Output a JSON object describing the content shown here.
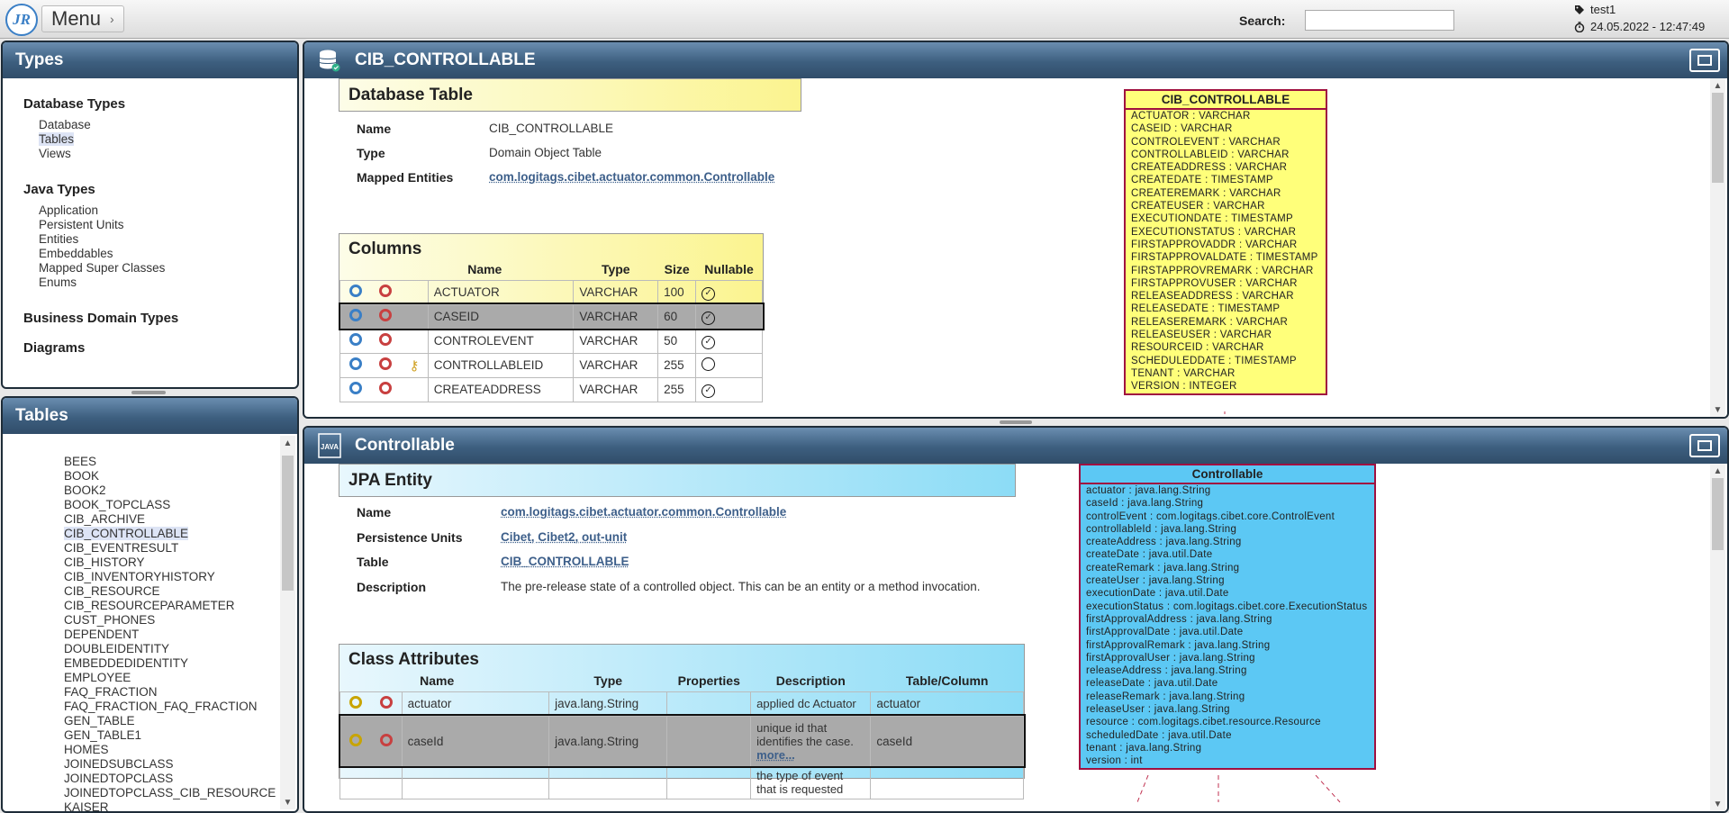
{
  "topbar": {
    "logo": "JR",
    "menu_label": "Menu",
    "search_label": "Search:",
    "search_value": "",
    "user": "test1",
    "datetime": "24.05.2022 - 12:47:49"
  },
  "types_panel": {
    "title": "Types",
    "groups": [
      {
        "label": "Database Types",
        "items": [
          "Database",
          "Tables",
          "Views"
        ]
      },
      {
        "label": "Java Types",
        "items": [
          "Application",
          "Persistent Units",
          "Entities",
          "Embeddables",
          "Mapped Super Classes",
          "Enums"
        ]
      },
      {
        "label": "Business Domain Types",
        "items": []
      },
      {
        "label": "Diagrams",
        "items": []
      }
    ],
    "selected_item": "Tables"
  },
  "tables_panel": {
    "title": "Tables",
    "items": [
      "BEES",
      "BOOK",
      "BOOK2",
      "BOOK_TOPCLASS",
      "CIB_ARCHIVE",
      "CIB_CONTROLLABLE",
      "CIB_EVENTRESULT",
      "CIB_HISTORY",
      "CIB_INVENTORYHISTORY",
      "CIB_RESOURCE",
      "CIB_RESOURCEPARAMETER",
      "CUST_PHONES",
      "DEPENDENT",
      "DOUBLEIDENTITY",
      "EMBEDDEDIDENTITY",
      "EMPLOYEE",
      "FAQ_FRACTION",
      "FAQ_FRACTION_FAQ_FRACTION",
      "GEN_TABLE",
      "GEN_TABLE1",
      "HOMES",
      "JOINEDSUBCLASS",
      "JOINEDTOPCLASS",
      "JOINEDTOPCLASS_CIB_RESOURCE",
      "KAISER"
    ],
    "selected": "CIB_CONTROLLABLE"
  },
  "db_panel": {
    "title": "CIB_CONTROLLABLE",
    "section_title": "Database Table",
    "props": [
      {
        "label": "Name",
        "value": "CIB_CONTROLLABLE"
      },
      {
        "label": "Type",
        "value": "Domain Object Table"
      },
      {
        "label": "Mapped Entities",
        "value": "com.logitags.cibet.actuator.common.Controllable"
      }
    ],
    "columns_title": "Columns",
    "columns_headers": [
      "Name",
      "Type",
      "Size",
      "Nullable"
    ],
    "columns": [
      {
        "name": "ACTUATOR",
        "type": "VARCHAR",
        "size": "100",
        "nullable": true,
        "key": false
      },
      {
        "name": "CASEID",
        "type": "VARCHAR",
        "size": "60",
        "nullable": true,
        "key": false
      },
      {
        "name": "CONTROLEVENT",
        "type": "VARCHAR",
        "size": "50",
        "nullable": true,
        "key": false
      },
      {
        "name": "CONTROLLABLEID",
        "type": "VARCHAR",
        "size": "255",
        "nullable": false,
        "key": true
      },
      {
        "name": "CREATEADDRESS",
        "type": "VARCHAR",
        "size": "255",
        "nullable": true,
        "key": false
      }
    ],
    "uml_title": "CIB_CONTROLLABLE",
    "uml_rows": [
      "ACTUATOR : VARCHAR",
      "CASEID : VARCHAR",
      "CONTROLEVENT : VARCHAR",
      "CONTROLLABLEID : VARCHAR",
      "CREATEADDRESS : VARCHAR",
      "CREATEDATE : TIMESTAMP",
      "CREATEREMARK : VARCHAR",
      "CREATEUSER : VARCHAR",
      "EXECUTIONDATE : TIMESTAMP",
      "EXECUTIONSTATUS : VARCHAR",
      "FIRSTAPPROVADDR : VARCHAR",
      "FIRSTAPPROVALDATE : TIMESTAMP",
      "FIRSTAPPROVREMARK : VARCHAR",
      "FIRSTAPPROVUSER : VARCHAR",
      "RELEASEADDRESS : VARCHAR",
      "RELEASEDATE : TIMESTAMP",
      "RELEASEREMARK : VARCHAR",
      "RELEASEUSER : VARCHAR",
      "RESOURCEID : VARCHAR",
      "SCHEDULEDDATE : TIMESTAMP",
      "TENANT : VARCHAR",
      "VERSION : INTEGER"
    ]
  },
  "jpa_panel": {
    "title": "Controllable",
    "icon_label": "JAVA",
    "section_title": "JPA Entity",
    "name_label": "Name",
    "name_value": "com.logitags.cibet.actuator.common.Controllable",
    "pu_label": "Persistence Units",
    "pu_values": [
      "Cibet",
      "Cibet2",
      "out-unit"
    ],
    "table_label": "Table",
    "table_value": "CIB_CONTROLLABLE",
    "desc_label": "Description",
    "desc_value": "The pre-release state of a controlled object. This can be an entity or a method invocation.",
    "attrs_title": "Class Attributes",
    "attrs_headers": [
      "Name",
      "Type",
      "Properties",
      "Description",
      "Table/Column"
    ],
    "attrs": [
      {
        "name": "actuator",
        "type": "java.lang.String",
        "props": "",
        "desc": "applied dc Actuator",
        "more": "",
        "col": "actuator"
      },
      {
        "name": "caseId",
        "type": "java.lang.String",
        "props": "",
        "desc": "unique id that identifies the case.",
        "more": "more...",
        "col": "caseId"
      },
      {
        "name": "",
        "type": "",
        "props": "",
        "desc": "the type of event that is requested",
        "more": "",
        "col": ""
      }
    ],
    "uml_title": "Controllable",
    "uml_rows": [
      "actuator : java.lang.String",
      "caseId : java.lang.String",
      "controlEvent : com.logitags.cibet.core.ControlEvent",
      "controllableId : java.lang.String",
      "createAddress : java.lang.String",
      "createDate : java.util.Date",
      "createRemark : java.lang.String",
      "createUser : java.lang.String",
      "executionDate : java.util.Date",
      "executionStatus : com.logitags.cibet.core.ExecutionStatus",
      "firstApprovalAddress : java.lang.String",
      "firstApprovalDate : java.util.Date",
      "firstApprovalRemark : java.lang.String",
      "firstApprovalUser : java.lang.String",
      "releaseAddress : java.lang.String",
      "releaseDate : java.util.Date",
      "releaseRemark : java.lang.String",
      "releaseUser : java.lang.String",
      "resource : com.logitags.cibet.resource.Resource",
      "scheduledDate : java.util.Date",
      "tenant : java.lang.String",
      "version : int"
    ]
  }
}
